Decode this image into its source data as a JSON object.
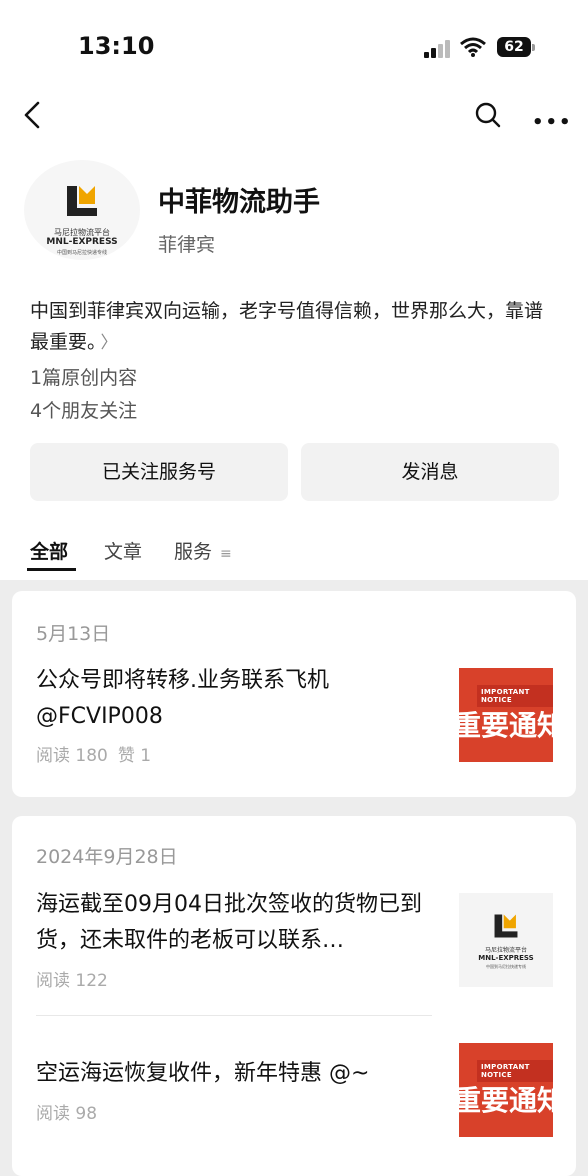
{
  "status": {
    "time": "13:10",
    "battery": "62"
  },
  "account": {
    "name": "中菲物流助手",
    "location": "菲律宾",
    "description": "中国到菲律宾双向运输，老字号值得信赖，世界那么大，靠谱最重要。",
    "original_count": "1篇原创内容",
    "friends_following": "4个朋友关注",
    "logo": {
      "cn_top": "马尼拉物流平台",
      "en": "MNL-EXPRESS",
      "cn_bottom": "中国到马尼拉快递专线"
    }
  },
  "buttons": {
    "followed": "已关注服务号",
    "message": "发消息"
  },
  "tabs": [
    {
      "label": "全部"
    },
    {
      "label": "文章"
    },
    {
      "label": "服务"
    }
  ],
  "posts": {
    "group1": {
      "date": "5月13日",
      "item": {
        "title": "公众号即将转移.业务联系飞机@FCVIP008",
        "reads": "阅读 180",
        "likes": "赞 1",
        "thumb_notice": "IMPORTANT NOTICE",
        "thumb_text": "重要通知"
      }
    },
    "group2": {
      "date": "2024年9月28日",
      "item1": {
        "title": "海运截至09月04日批次签收的货物已到货，还未取件的老板可以联系…",
        "reads": "阅读 122"
      },
      "item2": {
        "title": "空运海运恢复收件，新年特惠 @~",
        "reads": "阅读 98",
        "thumb_notice": "IMPORTANT NOTICE",
        "thumb_text": "重要通知"
      }
    }
  },
  "colors": {
    "accent_red": "#d8412a",
    "logo_orange": "#f0a500"
  }
}
